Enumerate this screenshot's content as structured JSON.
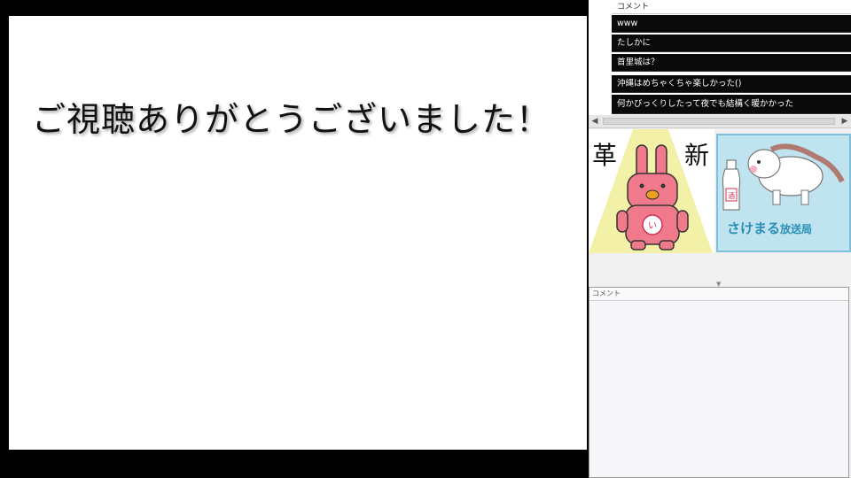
{
  "stage": {
    "message": "ご視聴ありがとうございました！"
  },
  "comment_list": {
    "header": "コメント",
    "rows": [
      "www",
      "たしかに",
      "首里城は？",
      "沖縄はめちゃくちゃ楽しかった()",
      "何かびっくりしたって夜でも結構く暖かかった"
    ]
  },
  "banner_left": {
    "left_kanji": "革",
    "right_kanji": "新"
  },
  "banner_right": {
    "caption": "さけまる",
    "caption_suffix": "放送局"
  },
  "comment_panel": {
    "title": "コメント"
  },
  "colors": {
    "rabbit_pink": "#f07a8c",
    "spotlight_yellow": "#f3f0a8",
    "banner_blue": "#bfe3ef",
    "caption_blue": "#2a8fb5"
  },
  "icons": [
    "scroll-left-icon",
    "scroll-right-icon",
    "rabbit-illustration",
    "horse-illustration",
    "sake-bottle-illustration"
  ]
}
